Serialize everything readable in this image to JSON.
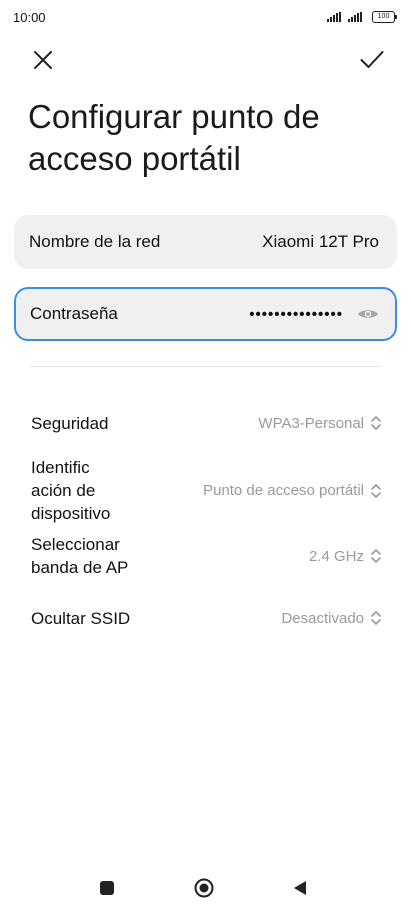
{
  "status": {
    "time": "10:00",
    "battery": "100"
  },
  "header": {
    "close_icon": "close-icon",
    "confirm_icon": "check-icon",
    "title": "Configurar punto de acceso portátil"
  },
  "fields": {
    "ssid": {
      "label": "Nombre de la red",
      "value": "Xiaomi 12T Pro"
    },
    "password": {
      "label": "Contraseña",
      "value": "•••••••••••••••",
      "visibility_icon": "eye-icon"
    }
  },
  "settings": [
    {
      "label": "Seguridad",
      "value": "WPA3-Personal"
    },
    {
      "label": "Identific ación de dispositivo",
      "value": "Punto de acceso portátil"
    },
    {
      "label": "Seleccionar banda de AP",
      "value": "2.4 GHz"
    },
    {
      "label": "Ocultar SSID",
      "value": "Desactivado"
    }
  ],
  "colors": {
    "accent": "#3a8ee6",
    "card_bg": "#f0f0f0",
    "secondary_text": "#9a9a9a"
  },
  "nav": {
    "recent_icon": "square-icon",
    "home_icon": "circle-icon",
    "back_icon": "triangle-back-icon"
  }
}
